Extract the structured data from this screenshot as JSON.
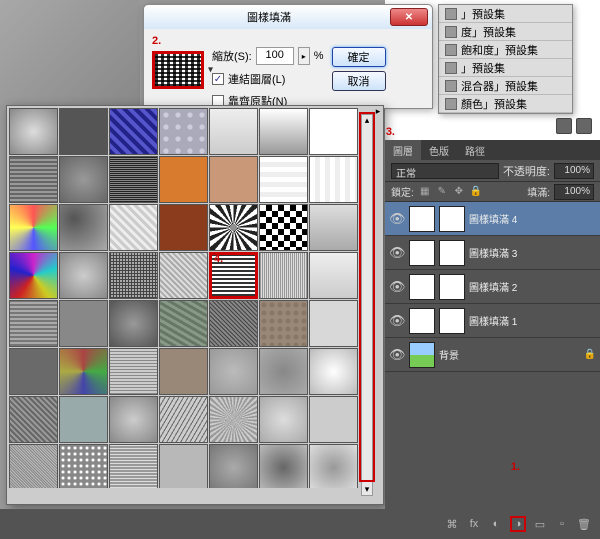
{
  "dialog": {
    "title": "圖樣填滿",
    "annotation": "2.",
    "scale_label": "縮放(S):",
    "scale_value": "100",
    "scale_unit": "%",
    "link_label": "連結圖層(L)",
    "snap_label": "靠齊原點(N)",
    "ok": "確定",
    "cancel": "取消"
  },
  "presets": {
    "items": [
      "」預設集",
      "度」預設集",
      "飽和度」預設集",
      "」預設集",
      "混合器」預設集",
      "顏色」預設集"
    ]
  },
  "picker": {
    "annotation3": "3.",
    "sel_annotation": "4."
  },
  "panels": {
    "tabs": [
      "圖層",
      "色版",
      "路徑"
    ],
    "blend_mode": "正常",
    "opacity_label": "不透明度:",
    "opacity_value": "100%",
    "lock_label": "鎖定:",
    "fill_label": "填滿:",
    "fill_value": "100%",
    "layers": [
      {
        "name": "圖樣填滿 4",
        "active": true
      },
      {
        "name": "圖樣填滿 3",
        "active": false
      },
      {
        "name": "圖樣填滿 2",
        "active": false
      },
      {
        "name": "圖樣填滿 1",
        "active": false
      },
      {
        "name": "背景",
        "active": false,
        "bg": true
      }
    ],
    "annotation1": "1."
  },
  "swatch_styles": [
    "background:radial-gradient(#ddd,#888)",
    "background:#555",
    "background:repeating-linear-gradient(45deg,#228 0 4px,#55c 4px 8px)",
    "background:radial-gradient(circle,#ccd 30%,#aab 31%) 0 0/12px 12px",
    "background:linear-gradient(#eee,#ccc)",
    "background:linear-gradient(#fff,#999)",
    "background:#fff",
    "background:repeating-linear-gradient(#666 0 2px,#999 2px 4px)",
    "background:radial-gradient(#999,#666)",
    "background:repeating-linear-gradient(#222 0 1px,#888 1px 2px)",
    "background:#d97b2e",
    "background:#c89878",
    "background:linear-gradient(#fff 50%,#eee 50%) 0 0/100% 10px",
    "background:linear-gradient(90deg,#fff 50%,#eee 50%) 0 0/10px 100%",
    "background:conic-gradient(#f55,#5f5,#55f,#ff5,#f55)",
    "background:radial-gradient(circle at 30% 30%,#555,#aaa)",
    "background:repeating-linear-gradient(45deg,#ccc 0 3px,#eee 3px 6px)",
    "background:#8a3c1c",
    "background:repeating-conic-gradient(#222 0 10deg,#fff 10deg 20deg)",
    "background:repeating-conic-gradient(#000 0 25%,#fff 25% 50%) 0 0/12px 12px",
    "background:linear-gradient(#ddd,#aaa)",
    "background:conic-gradient(#c2c,#2cc,#cc2,#c22,#22c,#c2c)",
    "background:radial-gradient(#ccc,#888)",
    "background:repeating-linear-gradient(90deg,#444 0 1px,transparent 1px 3px),repeating-linear-gradient(0deg,#444 0 1px,transparent 1px 3px) #aaa",
    "background:repeating-linear-gradient(45deg,#aaa 0 2px,#ddd 2px 4px)",
    "background:repeating-linear-gradient(0deg,#333 0 2px,#fff 2px 4px)",
    "background:repeating-linear-gradient(90deg,#999 0 1px,#ddd 1px 2px)",
    "background:linear-gradient(#eee,#ccc)",
    "background:repeating-linear-gradient(0deg,#777 0 2px,#aaa 2px 4px)",
    "background:#888",
    "background:radial-gradient(#999,#555)",
    "background:repeating-linear-gradient(30deg,#676 0 3px,#898 3px 6px)",
    "background:repeating-linear-gradient(45deg,#444 0 1px,#888 1px 3px)",
    "background:radial-gradient(circle,#887766 2px,#998877 3px) 0 0/8px 8px",
    "background:#d8d8d8",
    "background:#6a6a6a",
    "background:conic-gradient(#a44,#4a4,#44a,#aa4,#a44)",
    "background:repeating-linear-gradient(0deg,#888 0 1px,#ccc 1px 3px)",
    "background:#987",
    "background:radial-gradient(#bbb,#999)",
    "background:radial-gradient(#888,#aaa)",
    "background:radial-gradient(circle,#fff,#bbb)",
    "background:repeating-linear-gradient(45deg,#666 0 2px,#999 2px 4px)",
    "background:#9aa",
    "background:radial-gradient(#ccc,#888)",
    "background:repeating-linear-gradient(120deg,#666 0 1px,#ccc 1px 4px)",
    "background:repeating-conic-gradient(#999 0 5deg,#ccc 5deg 10deg)",
    "background:radial-gradient(#ddd,#aaa)",
    "background:#ccc",
    "background:repeating-linear-gradient(45deg,#888 0 1px,#bbb 1px 2px)",
    "background:radial-gradient(circle,#fff 1px,#888 2px) 0 0/6px 6px",
    "background:repeating-linear-gradient(0deg,#999 0 2px,#ddd 2px 3px)",
    "background:#b8b8b8",
    "background:radial-gradient(#aaa,#777)",
    "background:radial-gradient(#666,#bbb)",
    "background:radial-gradient(#999,#ddd)"
  ]
}
